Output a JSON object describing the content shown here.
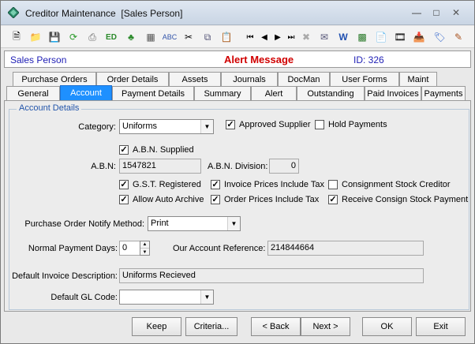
{
  "window": {
    "title": "Creditor Maintenance  [Sales Person]"
  },
  "header": {
    "person": "Sales Person",
    "alert": "Alert Message",
    "id": "ID: 326"
  },
  "tabs_row1": [
    "Purchase Orders",
    "Order Details",
    "Assets",
    "Journals",
    "DocMan",
    "User Forms",
    "Maint"
  ],
  "tabs_row2": [
    "General",
    "Account",
    "Payment Details",
    "Summary",
    "Alert",
    "Outstanding",
    "Paid Invoices",
    "Payments"
  ],
  "active_tab": "Account",
  "section": {
    "title": "Account Details"
  },
  "form": {
    "category_label": "Category:",
    "category_value": "Uniforms",
    "approved_supplier_label": "Approved Supplier",
    "approved_supplier_checked": true,
    "hold_payments_label": "Hold Payments",
    "hold_payments_checked": false,
    "abn_supplied_label": "A.B.N. Supplied",
    "abn_supplied_checked": true,
    "abn_label": "A.B.N:",
    "abn_value": "1547821",
    "abn_division_label": "A.B.N. Division:",
    "abn_division_value": "0",
    "gst_registered_label": "G.S.T. Registered",
    "invoice_prices_tax_label": "Invoice Prices Include Tax",
    "consignment_creditor_label": "Consignment Stock Creditor",
    "allow_auto_archive_label": "Allow Auto Archive",
    "order_prices_tax_label": "Order Prices Include Tax",
    "receive_consign_label": "Receive Consign Stock Payment",
    "po_notify_label": "Purchase Order Notify Method:",
    "po_notify_value": "Print",
    "payment_days_label": "Normal Payment Days:",
    "payment_days_value": "0",
    "our_ref_label": "Our Account Reference:",
    "our_ref_value": "214844664",
    "default_invoice_desc_label": "Default Invoice Description:",
    "default_invoice_desc_value": "Uniforms Recieved",
    "default_gl_label": "Default GL Code:",
    "default_gl_value": ""
  },
  "buttons": {
    "keep": "Keep",
    "criteria": "Criteria...",
    "back": "< Back",
    "next": "Next >",
    "ok": "OK",
    "exit": "Exit"
  },
  "colors": {
    "active_tab": "#1e90ff",
    "alert": "#d00000",
    "header_text": "#1f1fb5"
  }
}
